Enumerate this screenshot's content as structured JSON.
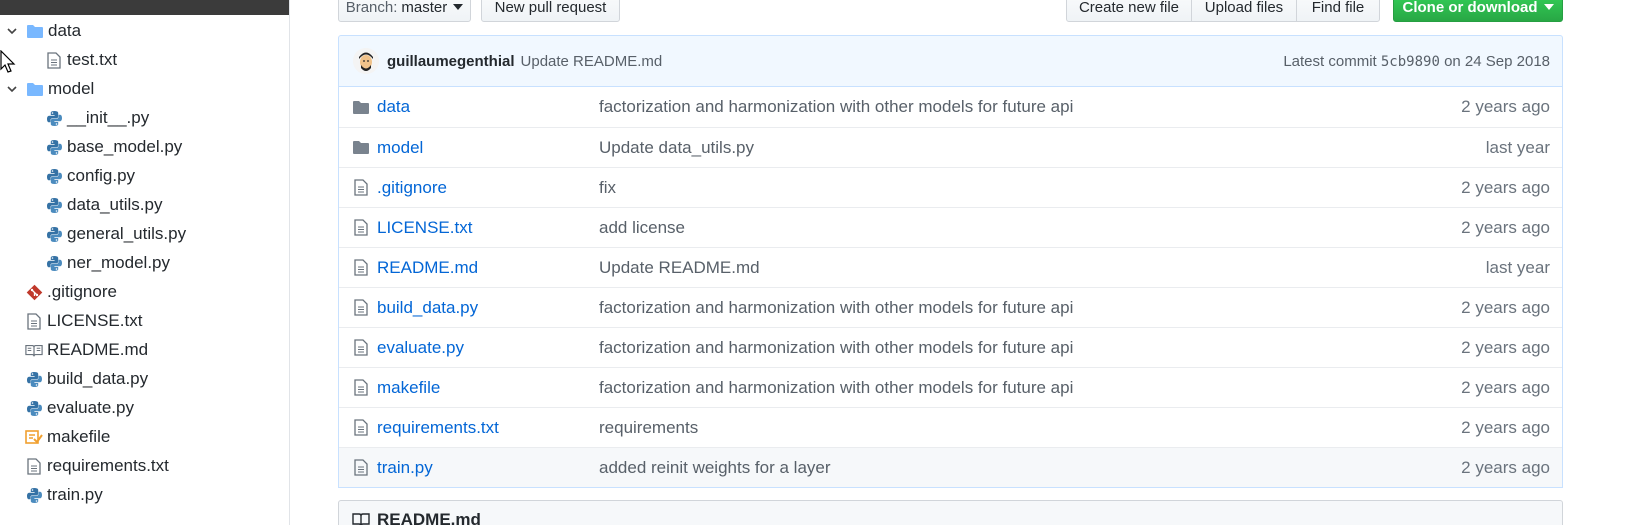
{
  "tree": {
    "items": [
      {
        "label": "data",
        "kind": "folder",
        "expanded": true,
        "depth": 0
      },
      {
        "label": "test.txt",
        "kind": "text",
        "depth": 1
      },
      {
        "label": "model",
        "kind": "folder",
        "expanded": true,
        "depth": 0
      },
      {
        "label": "__init__.py",
        "kind": "python",
        "depth": 1
      },
      {
        "label": "base_model.py",
        "kind": "python",
        "depth": 1
      },
      {
        "label": "config.py",
        "kind": "python",
        "depth": 1
      },
      {
        "label": "data_utils.py",
        "kind": "python",
        "depth": 1
      },
      {
        "label": "general_utils.py",
        "kind": "python",
        "depth": 1
      },
      {
        "label": "ner_model.py",
        "kind": "python",
        "depth": 1
      },
      {
        "label": ".gitignore",
        "kind": "git",
        "depth": 0
      },
      {
        "label": "LICENSE.txt",
        "kind": "text",
        "depth": 0
      },
      {
        "label": "README.md",
        "kind": "readme",
        "depth": 0
      },
      {
        "label": "build_data.py",
        "kind": "python",
        "depth": 0
      },
      {
        "label": "evaluate.py",
        "kind": "python",
        "depth": 0
      },
      {
        "label": "makefile",
        "kind": "makefile",
        "depth": 0
      },
      {
        "label": "requirements.txt",
        "kind": "text",
        "depth": 0
      },
      {
        "label": "train.py",
        "kind": "python",
        "depth": 0
      }
    ]
  },
  "toolbar": {
    "branch_label": "Branch:",
    "branch_value": "master",
    "new_pr": "New pull request",
    "create_file": "Create new file",
    "upload_files": "Upload files",
    "find_file": "Find file",
    "clone": "Clone or download"
  },
  "commit": {
    "author": "guillaumegenthial",
    "message": "Update README.md",
    "latest_label": "Latest commit",
    "sha": "5cb9890",
    "on_label": "on",
    "date": "24 Sep 2018"
  },
  "files": [
    {
      "name": "data",
      "kind": "folder",
      "message": "factorization and harmonization with other models for future api",
      "age": "2 years ago"
    },
    {
      "name": "model",
      "kind": "folder",
      "message": "Update data_utils.py",
      "age": "last year"
    },
    {
      "name": ".gitignore",
      "kind": "file",
      "message": "fix",
      "age": "2 years ago"
    },
    {
      "name": "LICENSE.txt",
      "kind": "file",
      "message": "add license",
      "age": "2 years ago"
    },
    {
      "name": "README.md",
      "kind": "file",
      "message": "Update README.md",
      "age": "last year"
    },
    {
      "name": "build_data.py",
      "kind": "file",
      "message": "factorization and harmonization with other models for future api",
      "age": "2 years ago"
    },
    {
      "name": "evaluate.py",
      "kind": "file",
      "message": "factorization and harmonization with other models for future api",
      "age": "2 years ago"
    },
    {
      "name": "makefile",
      "kind": "file",
      "message": "factorization and harmonization with other models for future api",
      "age": "2 years ago"
    },
    {
      "name": "requirements.txt",
      "kind": "file",
      "message": "requirements",
      "age": "2 years ago"
    },
    {
      "name": "train.py",
      "kind": "file",
      "message": "added reinit weights for a layer",
      "age": "2 years ago"
    }
  ],
  "readme": {
    "title": "README.md"
  },
  "colors": {
    "link": "#0366d6",
    "green": "#28a745",
    "folder": "#79b8ff",
    "python": "#3572a5",
    "git": "#c0392b",
    "make": "#f0a030"
  }
}
